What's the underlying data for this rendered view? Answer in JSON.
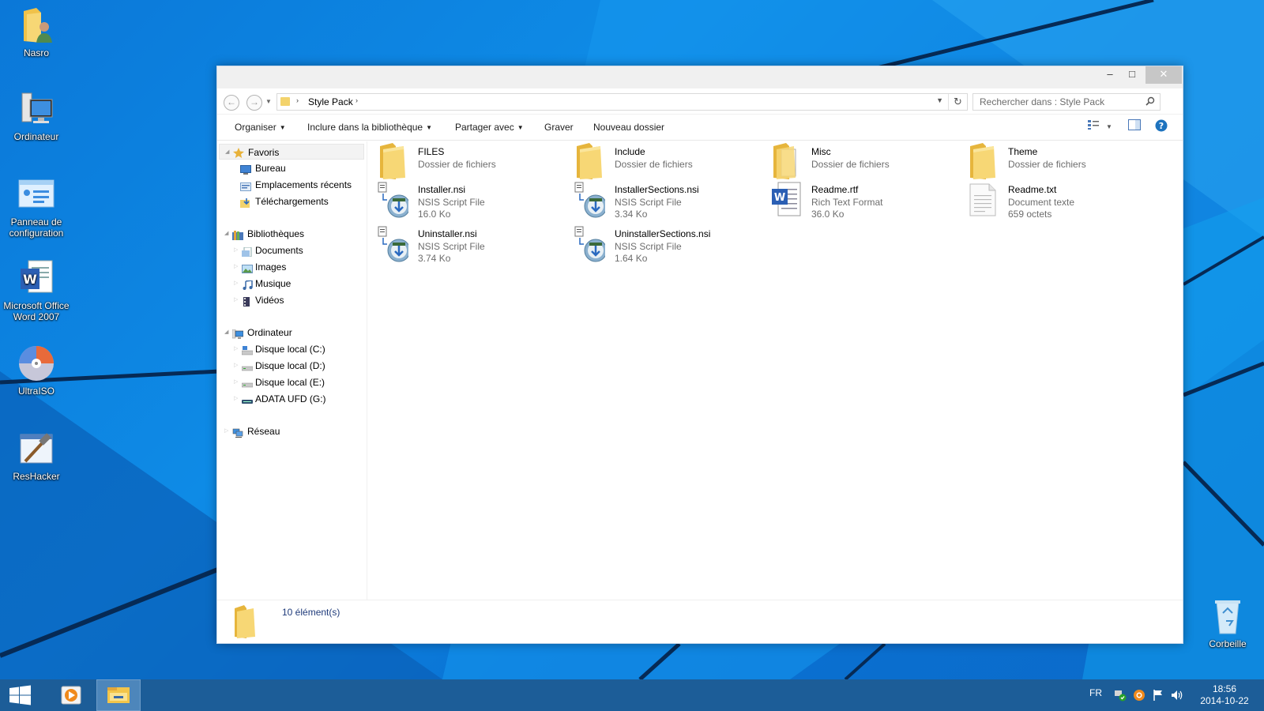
{
  "desktop": {
    "icons": [
      {
        "label": "Nasro",
        "icon": "user-folder-icon"
      },
      {
        "label": "Ordinateur",
        "icon": "computer-icon"
      },
      {
        "label": "Panneau de configuration",
        "icon": "control-panel-icon"
      },
      {
        "label": "Microsoft Office Word 2007",
        "icon": "word-icon"
      },
      {
        "label": "UltraISO",
        "icon": "disc-icon"
      },
      {
        "label": "ResHacker",
        "icon": "reshacker-icon"
      },
      {
        "label": "Corbeille",
        "icon": "recycle-bin-icon"
      }
    ]
  },
  "window": {
    "title_buttons": {
      "minimize": "–",
      "maximize": "□",
      "close": "✕"
    },
    "address": {
      "crumb": "Style Pack",
      "separator": "›",
      "search_placeholder": "Rechercher dans : Style Pack"
    },
    "commands": {
      "organize": "Organiser",
      "include": "Inclure dans la bibliothèque",
      "share": "Partager avec",
      "burn": "Graver",
      "new_folder": "Nouveau dossier"
    },
    "nav_pane": {
      "favorites": {
        "label": "Favoris",
        "items": [
          "Bureau",
          "Emplacements récents",
          "Téléchargements"
        ]
      },
      "libraries": {
        "label": "Bibliothèques",
        "items": [
          "Documents",
          "Images",
          "Musique",
          "Vidéos"
        ]
      },
      "computer": {
        "label": "Ordinateur",
        "items": [
          "Disque local (C:)",
          "Disque local (D:)",
          "Disque local (E:)",
          "ADATA UFD (G:)"
        ]
      },
      "network": {
        "label": "Réseau"
      }
    },
    "files": [
      {
        "name": "FILES",
        "type": "Dossier de fichiers",
        "size": "",
        "icon": "folder-icon"
      },
      {
        "name": "Include",
        "type": "Dossier de fichiers",
        "size": "",
        "icon": "folder-icon"
      },
      {
        "name": "Misc",
        "type": "Dossier de fichiers",
        "size": "",
        "icon": "folder-icon"
      },
      {
        "name": "Theme",
        "type": "Dossier de fichiers",
        "size": "",
        "icon": "folder-icon"
      },
      {
        "name": "Installer.nsi",
        "type": "NSIS Script File",
        "size": "16.0 Ko",
        "icon": "nsis-script-icon"
      },
      {
        "name": "InstallerSections.nsi",
        "type": "NSIS Script File",
        "size": "3.34 Ko",
        "icon": "nsis-script-icon"
      },
      {
        "name": "Readme.rtf",
        "type": "Rich Text Format",
        "size": "36.0 Ko",
        "icon": "rtf-document-icon"
      },
      {
        "name": "Readme.txt",
        "type": "Document texte",
        "size": "659 octets",
        "icon": "text-document-icon"
      },
      {
        "name": "Uninstaller.nsi",
        "type": "NSIS Script File",
        "size": "3.74 Ko",
        "icon": "nsis-script-icon"
      },
      {
        "name": "UninstallerSections.nsi",
        "type": "NSIS Script File",
        "size": "1.64 Ko",
        "icon": "nsis-script-icon"
      }
    ],
    "status": {
      "count": "10 élément(s)"
    }
  },
  "taskbar": {
    "language": "FR",
    "time": "18:56",
    "date": "2014-10-22"
  },
  "colors": {
    "desktop_blue": "#0b78d8",
    "taskbar": "#1c5d98",
    "folder_yellow": "#f3d36c",
    "accent_blue": "#1e73be"
  }
}
